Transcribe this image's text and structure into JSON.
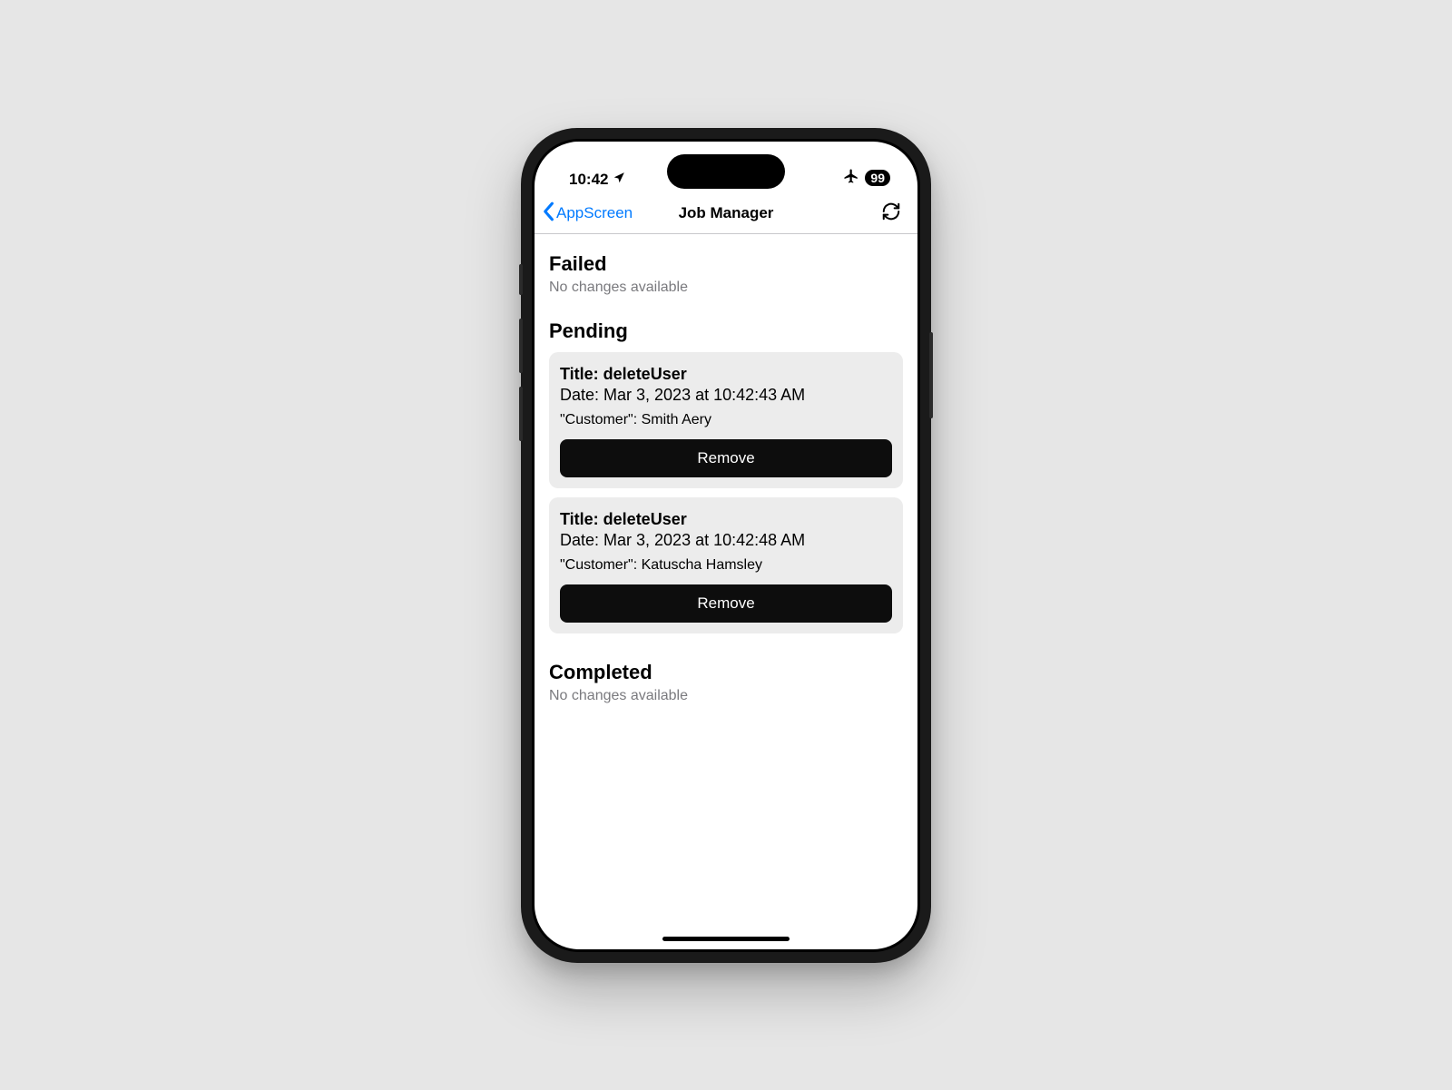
{
  "status_bar": {
    "time": "10:42",
    "battery": "99"
  },
  "nav": {
    "back_label": "AppScreen",
    "title": "Job Manager"
  },
  "sections": {
    "failed": {
      "header": "Failed",
      "empty": "No changes available"
    },
    "pending": {
      "header": "Pending",
      "items": [
        {
          "title": "Title: deleteUser",
          "date": "Date: Mar 3, 2023 at 10:42:43 AM",
          "customer": "\"Customer\": Smith Aery",
          "remove_label": "Remove"
        },
        {
          "title": "Title: deleteUser",
          "date": "Date: Mar 3, 2023 at 10:42:48 AM",
          "customer": "\"Customer\": Katuscha Hamsley",
          "remove_label": "Remove"
        }
      ]
    },
    "completed": {
      "header": "Completed",
      "empty": "No changes available"
    }
  }
}
